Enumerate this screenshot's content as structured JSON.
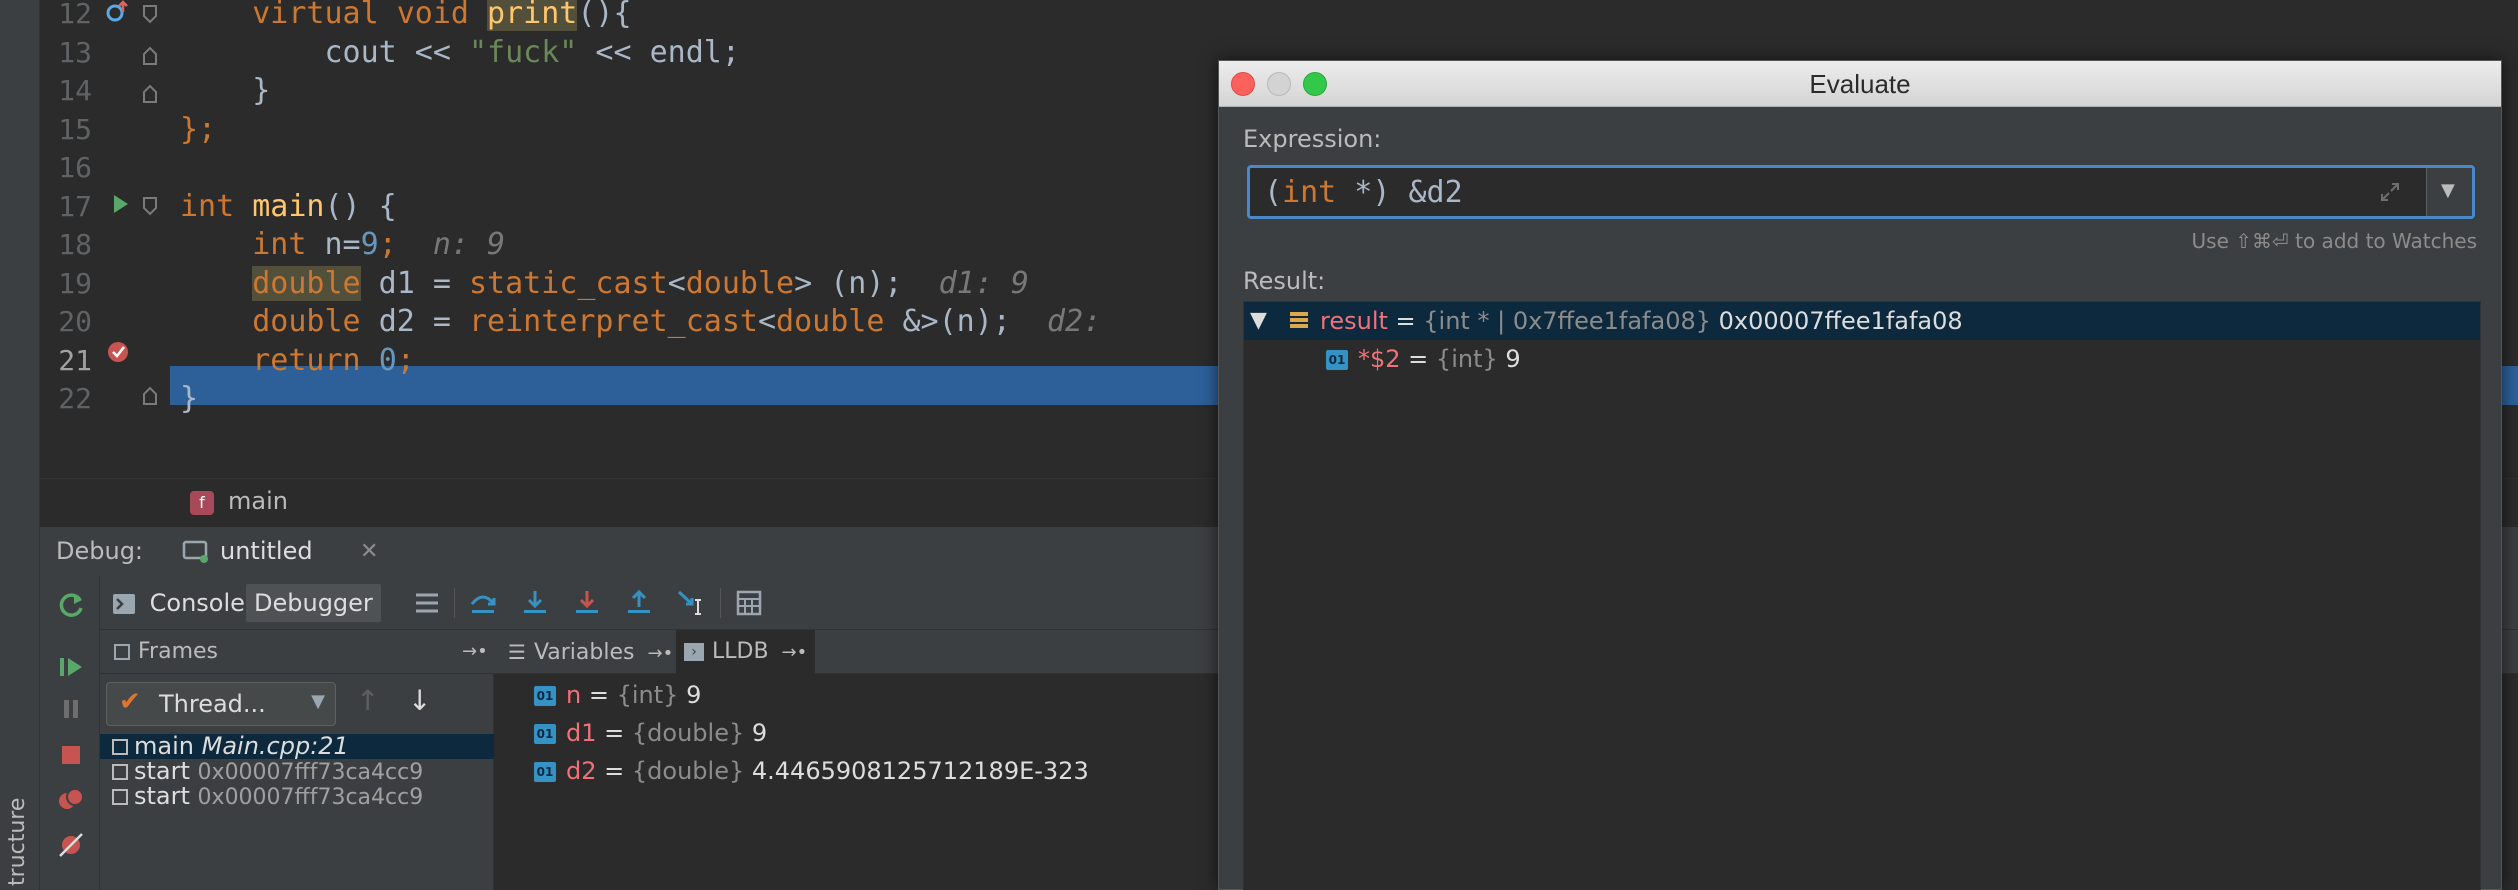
{
  "editor": {
    "lines": [
      {
        "num": "12",
        "segments": [
          {
            "t": "    virtual void ",
            "c": "kw"
          },
          {
            "t": "print",
            "c": "fn mark"
          },
          {
            "t": "(){",
            "c": "def"
          }
        ]
      },
      {
        "num": "13",
        "segments": [
          {
            "t": "        cout << ",
            "c": "def"
          },
          {
            "t": "\"fuck\"",
            "c": "str"
          },
          {
            "t": " << endl;",
            "c": "def"
          }
        ]
      },
      {
        "num": "14",
        "segments": [
          {
            "t": "    }",
            "c": "def"
          }
        ]
      },
      {
        "num": "15",
        "segments": [
          {
            "t": "};",
            "c": "kw"
          }
        ]
      },
      {
        "num": "16",
        "segments": []
      },
      {
        "num": "17",
        "segments": [
          {
            "t": "int ",
            "c": "kw"
          },
          {
            "t": "main",
            "c": "fn"
          },
          {
            "t": "() {",
            "c": "def"
          }
        ]
      },
      {
        "num": "18",
        "segments": [
          {
            "t": "    int ",
            "c": "kw"
          },
          {
            "t": "n=",
            "c": "def"
          },
          {
            "t": "9",
            "c": "num"
          },
          {
            "t": ";",
            "c": "kw"
          },
          {
            "t": "  n: 9",
            "c": "hint"
          }
        ]
      },
      {
        "num": "19",
        "segments": [
          {
            "t": "    ",
            "c": "def"
          },
          {
            "t": "double",
            "c": "kw mark"
          },
          {
            "t": " d1 = ",
            "c": "def"
          },
          {
            "t": "static_cast",
            "c": "kw"
          },
          {
            "t": "<",
            "c": "def"
          },
          {
            "t": "double",
            "c": "kw"
          },
          {
            "t": "> (n);",
            "c": "def"
          },
          {
            "t": "  d1: 9",
            "c": "hint"
          }
        ]
      },
      {
        "num": "20",
        "segments": [
          {
            "t": "    double ",
            "c": "kw"
          },
          {
            "t": "d2 = ",
            "c": "def"
          },
          {
            "t": "reinterpret_cast",
            "c": "kw"
          },
          {
            "t": "<",
            "c": "def"
          },
          {
            "t": "double",
            "c": "kw"
          },
          {
            "t": " &>(n);",
            "c": "def"
          },
          {
            "t": "  d2:",
            "c": "hint"
          }
        ]
      },
      {
        "num": "21",
        "segments": [
          {
            "t": "    return ",
            "c": "kw"
          },
          {
            "t": "0",
            "c": "num"
          },
          {
            "t": ";",
            "c": "kw"
          }
        ]
      },
      {
        "num": "22",
        "segments": [
          {
            "t": "}",
            "c": "def"
          }
        ]
      }
    ]
  },
  "breadcrumb": {
    "badge": "f",
    "label": "main"
  },
  "debug": {
    "label": "Debug:",
    "tab": "untitled",
    "toolbar": {
      "console": "Console",
      "debugger": "Debugger"
    },
    "subheaders": {
      "frames": "Frames",
      "variables": "Variables",
      "lldb": "LLDB"
    },
    "thread": "Thread...",
    "frames": [
      {
        "name": "main",
        "detail": "Main.cpp:21"
      },
      {
        "name": "start",
        "detail": "0x00007fff73ca4cc9"
      },
      {
        "name": "start",
        "detail": "0x00007fff73ca4cc9"
      }
    ],
    "variables": [
      {
        "badge": "01",
        "name": "n",
        "eq": " = ",
        "type": "{int}",
        "value": "9"
      },
      {
        "badge": "01",
        "name": "d1",
        "eq": " = ",
        "type": "{double}",
        "value": "9"
      },
      {
        "badge": "01",
        "name": "d2",
        "eq": " = ",
        "type": "{double}",
        "value": "4.4465908125712189E-323"
      }
    ]
  },
  "structure_label": "tructure",
  "dialog": {
    "title": "Evaluate",
    "expression_label": "Expression:",
    "expression": "(int *) &d2",
    "watch_hint": "Use ⇧⌘⏎ to add to Watches",
    "result_label": "Result:",
    "result": {
      "name": "result",
      "type": "{int * | 0x7ffee1fafa08}",
      "value": "0x00007ffee1fafa08",
      "child": {
        "badge": "01",
        "name": "*$2",
        "type": "{int}",
        "value": "9"
      }
    }
  },
  "colors": {
    "accent": "#2d6099",
    "selection": "#0d293e",
    "close": "#fc605c",
    "minimize": "#d3d3d3",
    "zoom": "#34c84a"
  }
}
